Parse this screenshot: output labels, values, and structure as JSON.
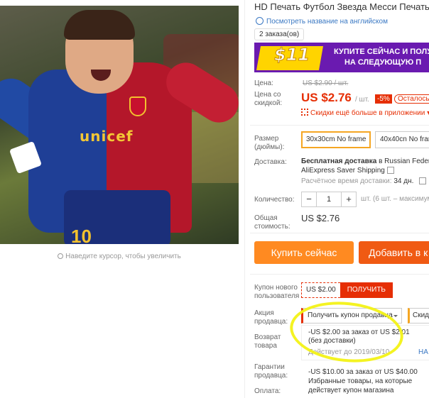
{
  "product": {
    "title": "HD Печать Футбол Звезда Месси Печать на х",
    "view_english": "Посмотреть название на английском",
    "orders": "2 заказа(ов)",
    "zoom_hint": "Наведите курсор, чтобы увеличить",
    "photo_sponsor": "unicef",
    "photo_number": "10"
  },
  "banner": {
    "amount": "$11",
    "text_line1": "КУПИТЕ СЕЙЧАС И ПОЛУ",
    "text_line2": "НА СЛЕДУЮЩУЮ П"
  },
  "price": {
    "label_price": "Цена:",
    "old": "US $2.90 / шт.",
    "label_discount": "Цена со скидкой:",
    "current": "US $2.76",
    "unit": "/ шт.",
    "discount": "-5%",
    "left": "Осталось",
    "app_discount": "Скидки ещё больше в приложении ▾"
  },
  "size": {
    "label": "Размер (дюймы):",
    "options": [
      "30x30cm No frame",
      "40x40cn No frar"
    ]
  },
  "shipping": {
    "label": "Доставка:",
    "line1_bold": "Бесплатная доставка",
    "line1_rest": " в Russian Federa",
    "method": "AliExpress Saver Shipping",
    "eta_prefix": "Расчётное время доставки:",
    "eta_value": "34 дн."
  },
  "quantity": {
    "label": "Количество:",
    "minus": "−",
    "value": "1",
    "plus": "+",
    "note": "шт. (6 шт. – максимум"
  },
  "total": {
    "label": "Общая стоимость:",
    "value": "US $2.76"
  },
  "buttons": {
    "buy": "Купить сейчас",
    "cart": "Добавить в к"
  },
  "coupons": {
    "new_user_label": "Купон нового пользователя",
    "new_user_amount": "US $2.00",
    "new_user_get": "ПОЛУЧИТЬ",
    "seller_label": "Акция продавца:",
    "seller_select": "Получить купон продавца",
    "seller_select2": "Скид",
    "c1_line1": "-US $2.00 за заказ от US $2.01",
    "c1_line2": "(без доставки)",
    "c1_expiry": "Действует до 2019/03/10",
    "c1_more": "НА",
    "c2_line1": "-US $10.00 за заказ от US $40.00",
    "c2_line2": "Избранные товары, на которые",
    "c2_line3": "действует купон магазина"
  },
  "labels": {
    "return": "Возврат товара",
    "guarantee": "Гарантии продавца:",
    "payment": "Оплата:"
  },
  "colors": {
    "accent": "#e62e04",
    "buy_button": "#ff8a21",
    "cart_button": "#f05a13",
    "banner_bg": "#6a1ab0",
    "annotation_circle": "#f3f216"
  }
}
